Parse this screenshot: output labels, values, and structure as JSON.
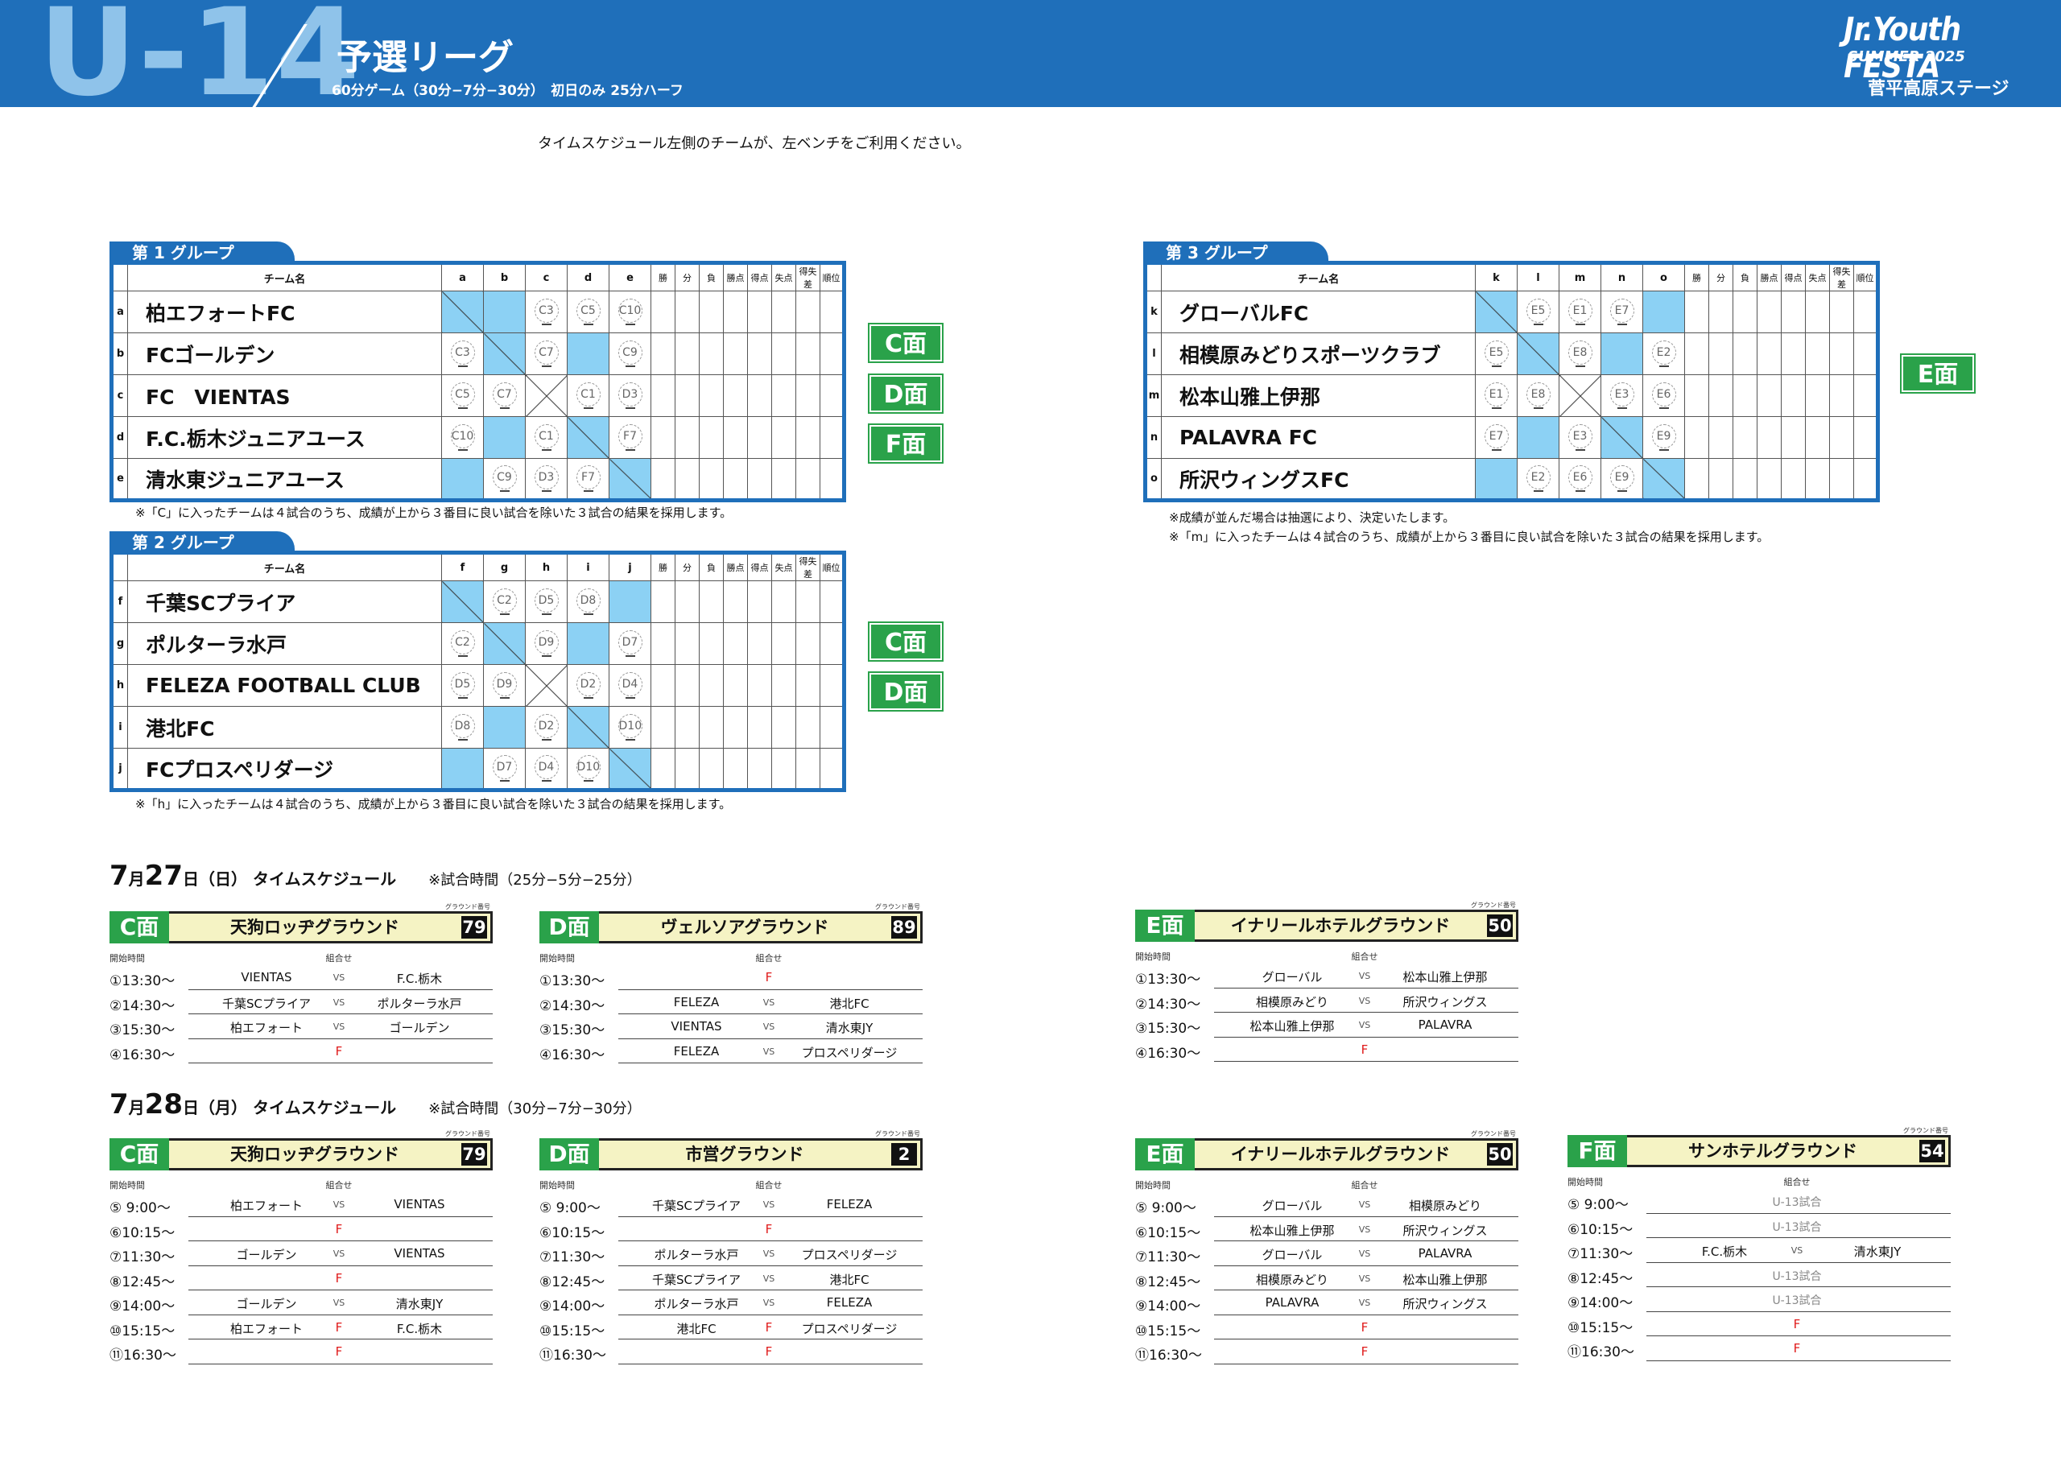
{
  "header": {
    "big": "U-14",
    "title": "予選リーグ",
    "subtitle": "60分ゲーム（30分−7分−30分）　初日のみ 25分ハーフ",
    "brand1": "Jr.Youth FESTA",
    "brand2": "SUMMER 2025",
    "stage": "菅平高原ステージ"
  },
  "notice": "タイムスケジュール左側のチームが、左ベンチをご利用ください。",
  "columns": {
    "team": "チーム名",
    "stats": [
      "勝",
      "分",
      "負",
      "勝点",
      "得点",
      "失点",
      "得失差",
      "順位"
    ]
  },
  "groups": [
    {
      "label": "第 1 グループ",
      "cols": [
        "a",
        "b",
        "c",
        "d",
        "e"
      ],
      "faces": [
        "C面",
        "D面",
        "F面"
      ],
      "rows": [
        {
          "idx": "a",
          "team": "柏エフォートFC",
          "cells": [
            "X",
            "",
            "C3",
            "C5",
            "C10"
          ]
        },
        {
          "idx": "b",
          "team": "FCゴールデン",
          "cells": [
            "C3",
            "X",
            "C7",
            "",
            "C9"
          ]
        },
        {
          "idx": "c",
          "team": "FC　VIENTAS",
          "cells": [
            "C5",
            "C7",
            "XX",
            "C1",
            "D3"
          ]
        },
        {
          "idx": "d",
          "team": "F.C.栃木ジュニアユース",
          "cells": [
            "C10",
            "",
            "C1",
            "X",
            "F7"
          ]
        },
        {
          "idx": "e",
          "team": "清水東ジュニアユース",
          "cells": [
            "",
            "C9",
            "D3",
            "F7",
            "X"
          ]
        }
      ],
      "note": "※「C」に入ったチームは４試合のうち、成績が上から３番目に良い試合を除いた３試合の結果を採用します。"
    },
    {
      "label": "第 2 グループ",
      "cols": [
        "f",
        "g",
        "h",
        "i",
        "j"
      ],
      "faces": [
        "C面",
        "D面"
      ],
      "rows": [
        {
          "idx": "f",
          "team": "千葉SCプライア",
          "cells": [
            "X",
            "C2",
            "D5",
            "D8",
            ""
          ]
        },
        {
          "idx": "g",
          "team": "ポルターラ水戸",
          "cells": [
            "C2",
            "X",
            "D9",
            "",
            "D7"
          ]
        },
        {
          "idx": "h",
          "team": "FELEZA FOOTBALL CLUB",
          "cells": [
            "D5",
            "D9",
            "XX",
            "D2",
            "D4"
          ]
        },
        {
          "idx": "i",
          "team": "港北FC",
          "cells": [
            "D8",
            "",
            "D2",
            "X",
            "D10"
          ]
        },
        {
          "idx": "j",
          "team": "FCプロスペリダージ",
          "cells": [
            "",
            "D7",
            "D4",
            "D10",
            "X"
          ]
        }
      ],
      "note": "※「h」に入ったチームは４試合のうち、成績が上から３番目に良い試合を除いた３試合の結果を採用します。"
    },
    {
      "label": "第 3 グループ",
      "cols": [
        "k",
        "l",
        "m",
        "n",
        "o"
      ],
      "faces": [
        "E面"
      ],
      "rows": [
        {
          "idx": "k",
          "team": "グローバルFC",
          "cells": [
            "X",
            "E5",
            "E1",
            "E7",
            ""
          ]
        },
        {
          "idx": "l",
          "team": "相模原みどりスポーツクラブ",
          "cells": [
            "E5",
            "X",
            "E8",
            "",
            "E2"
          ]
        },
        {
          "idx": "m",
          "team": "松本山雅上伊那",
          "cells": [
            "E1",
            "E8",
            "XX",
            "E3",
            "E6"
          ]
        },
        {
          "idx": "n",
          "team": "PALAVRA FC",
          "cells": [
            "E7",
            "",
            "E3",
            "X",
            "E9"
          ]
        },
        {
          "idx": "o",
          "team": "所沢ウィングスFC",
          "cells": [
            "",
            "E2",
            "E6",
            "E9",
            "X"
          ]
        }
      ],
      "note": "※成績が並んだ場合は抽選により、決定いたします。",
      "note2": "※「m」に入ったチームは４試合のうち、成績が上から３番目に良い試合を除いた３試合の結果を採用します。"
    }
  ],
  "days": [
    {
      "m": "7",
      "mu": "月",
      "d": "27",
      "du": "日",
      "wd": "（日）",
      "label": "タイムスケジュール",
      "note": "※試合時間（25分−5分−25分）"
    },
    {
      "m": "7",
      "mu": "月",
      "d": "28",
      "du": "日",
      "wd": "（月）",
      "label": "タイムスケジュール",
      "note": "※試合時間（30分−7分−30分）"
    }
  ],
  "sched_labels": {
    "ground_no": "グラウンド番号",
    "start": "開始時間",
    "match": "組合せ",
    "vs": "VS",
    "f": "F"
  },
  "schedules": [
    {
      "face": "C面",
      "ground": "天狗ロッヂグラウンド",
      "num": "79",
      "rows": [
        {
          "t": "①13:30～",
          "l": "VIENTAS",
          "r": "F.C.栃木"
        },
        {
          "t": "②14:30～",
          "l": "千葉SCプライア",
          "r": "ポルターラ水戸"
        },
        {
          "t": "③15:30～",
          "l": "柏エフォート",
          "r": "ゴールデン"
        },
        {
          "t": "④16:30～",
          "f": "F"
        }
      ]
    },
    {
      "face": "D面",
      "ground": "ヴェルソアグラウンド",
      "num": "89",
      "rows": [
        {
          "t": "①13:30～",
          "f": "F"
        },
        {
          "t": "②14:30～",
          "l": "FELEZA",
          "r": "港北FC"
        },
        {
          "t": "③15:30～",
          "l": "VIENTAS",
          "r": "清水東JY"
        },
        {
          "t": "④16:30～",
          "l": "FELEZA",
          "r": "プロスペリダージ"
        }
      ]
    },
    {
      "face": "E面",
      "ground": "イナリールホテルグラウンド",
      "num": "50",
      "rows": [
        {
          "t": "①13:30～",
          "l": "グローバル",
          "r": "松本山雅上伊那"
        },
        {
          "t": "②14:30～",
          "l": "相模原みどり",
          "r": "所沢ウィングス"
        },
        {
          "t": "③15:30～",
          "l": "松本山雅上伊那",
          "r": "PALAVRA"
        },
        {
          "t": "④16:30～",
          "f": "F"
        }
      ]
    },
    {
      "face": "C面",
      "ground": "天狗ロッヂグラウンド",
      "num": "79",
      "rows": [
        {
          "t": "⑤ 9:00～",
          "l": "柏エフォート",
          "r": "VIENTAS"
        },
        {
          "t": "⑥10:15～",
          "f": "F"
        },
        {
          "t": "⑦11:30～",
          "l": "ゴールデン",
          "r": "VIENTAS"
        },
        {
          "t": "⑧12:45～",
          "f": "F"
        },
        {
          "t": "⑨14:00～",
          "l": "ゴールデン",
          "r": "清水東JY"
        },
        {
          "t": "⑩15:15～",
          "l": "柏エフォート",
          "fv": "F",
          "r": "F.C.栃木"
        },
        {
          "t": "⑪16:30～",
          "f": "F"
        }
      ]
    },
    {
      "face": "D面",
      "ground": "市営グラウンド",
      "num": "2",
      "rows": [
        {
          "t": "⑤ 9:00～",
          "l": "千葉SCプライア",
          "r": "FELEZA"
        },
        {
          "t": "⑥10:15～",
          "f": "F"
        },
        {
          "t": "⑦11:30～",
          "l": "ポルターラ水戸",
          "r": "プロスペリダージ"
        },
        {
          "t": "⑧12:45～",
          "l": "千葉SCプライア",
          "r": "港北FC"
        },
        {
          "t": "⑨14:00～",
          "l": "ポルターラ水戸",
          "r": "FELEZA"
        },
        {
          "t": "⑩15:15～",
          "l": "港北FC",
          "fv": "F",
          "r": "プロスペリダージ"
        },
        {
          "t": "⑪16:30～",
          "f": "F"
        }
      ]
    },
    {
      "face": "E面",
      "ground": "イナリールホテルグラウンド",
      "num": "50",
      "rows": [
        {
          "t": "⑤ 9:00～",
          "l": "グローバル",
          "r": "相模原みどり"
        },
        {
          "t": "⑥10:15～",
          "l": "松本山雅上伊那",
          "r": "所沢ウィングス"
        },
        {
          "t": "⑦11:30～",
          "l": "グローバル",
          "r": "PALAVRA"
        },
        {
          "t": "⑧12:45～",
          "l": "相模原みどり",
          "r": "松本山雅上伊那"
        },
        {
          "t": "⑨14:00～",
          "l": "PALAVRA",
          "r": "所沢ウィングス"
        },
        {
          "t": "⑩15:15～",
          "f": "F"
        },
        {
          "t": "⑪16:30～",
          "f": "F"
        }
      ]
    },
    {
      "face": "F面",
      "ground": "サンホテルグラウンド",
      "num": "54",
      "rows": [
        {
          "t": "⑤ 9:00～",
          "u": "U-13試合"
        },
        {
          "t": "⑥10:15～",
          "u": "U-13試合"
        },
        {
          "t": "⑦11:30～",
          "l": "F.C.栃木",
          "r": "清水東JY"
        },
        {
          "t": "⑧12:45～",
          "u": "U-13試合"
        },
        {
          "t": "⑨14:00～",
          "u": "U-13試合"
        },
        {
          "t": "⑩15:15～",
          "f": "F"
        },
        {
          "t": "⑪16:30～",
          "f": "F"
        }
      ]
    }
  ]
}
